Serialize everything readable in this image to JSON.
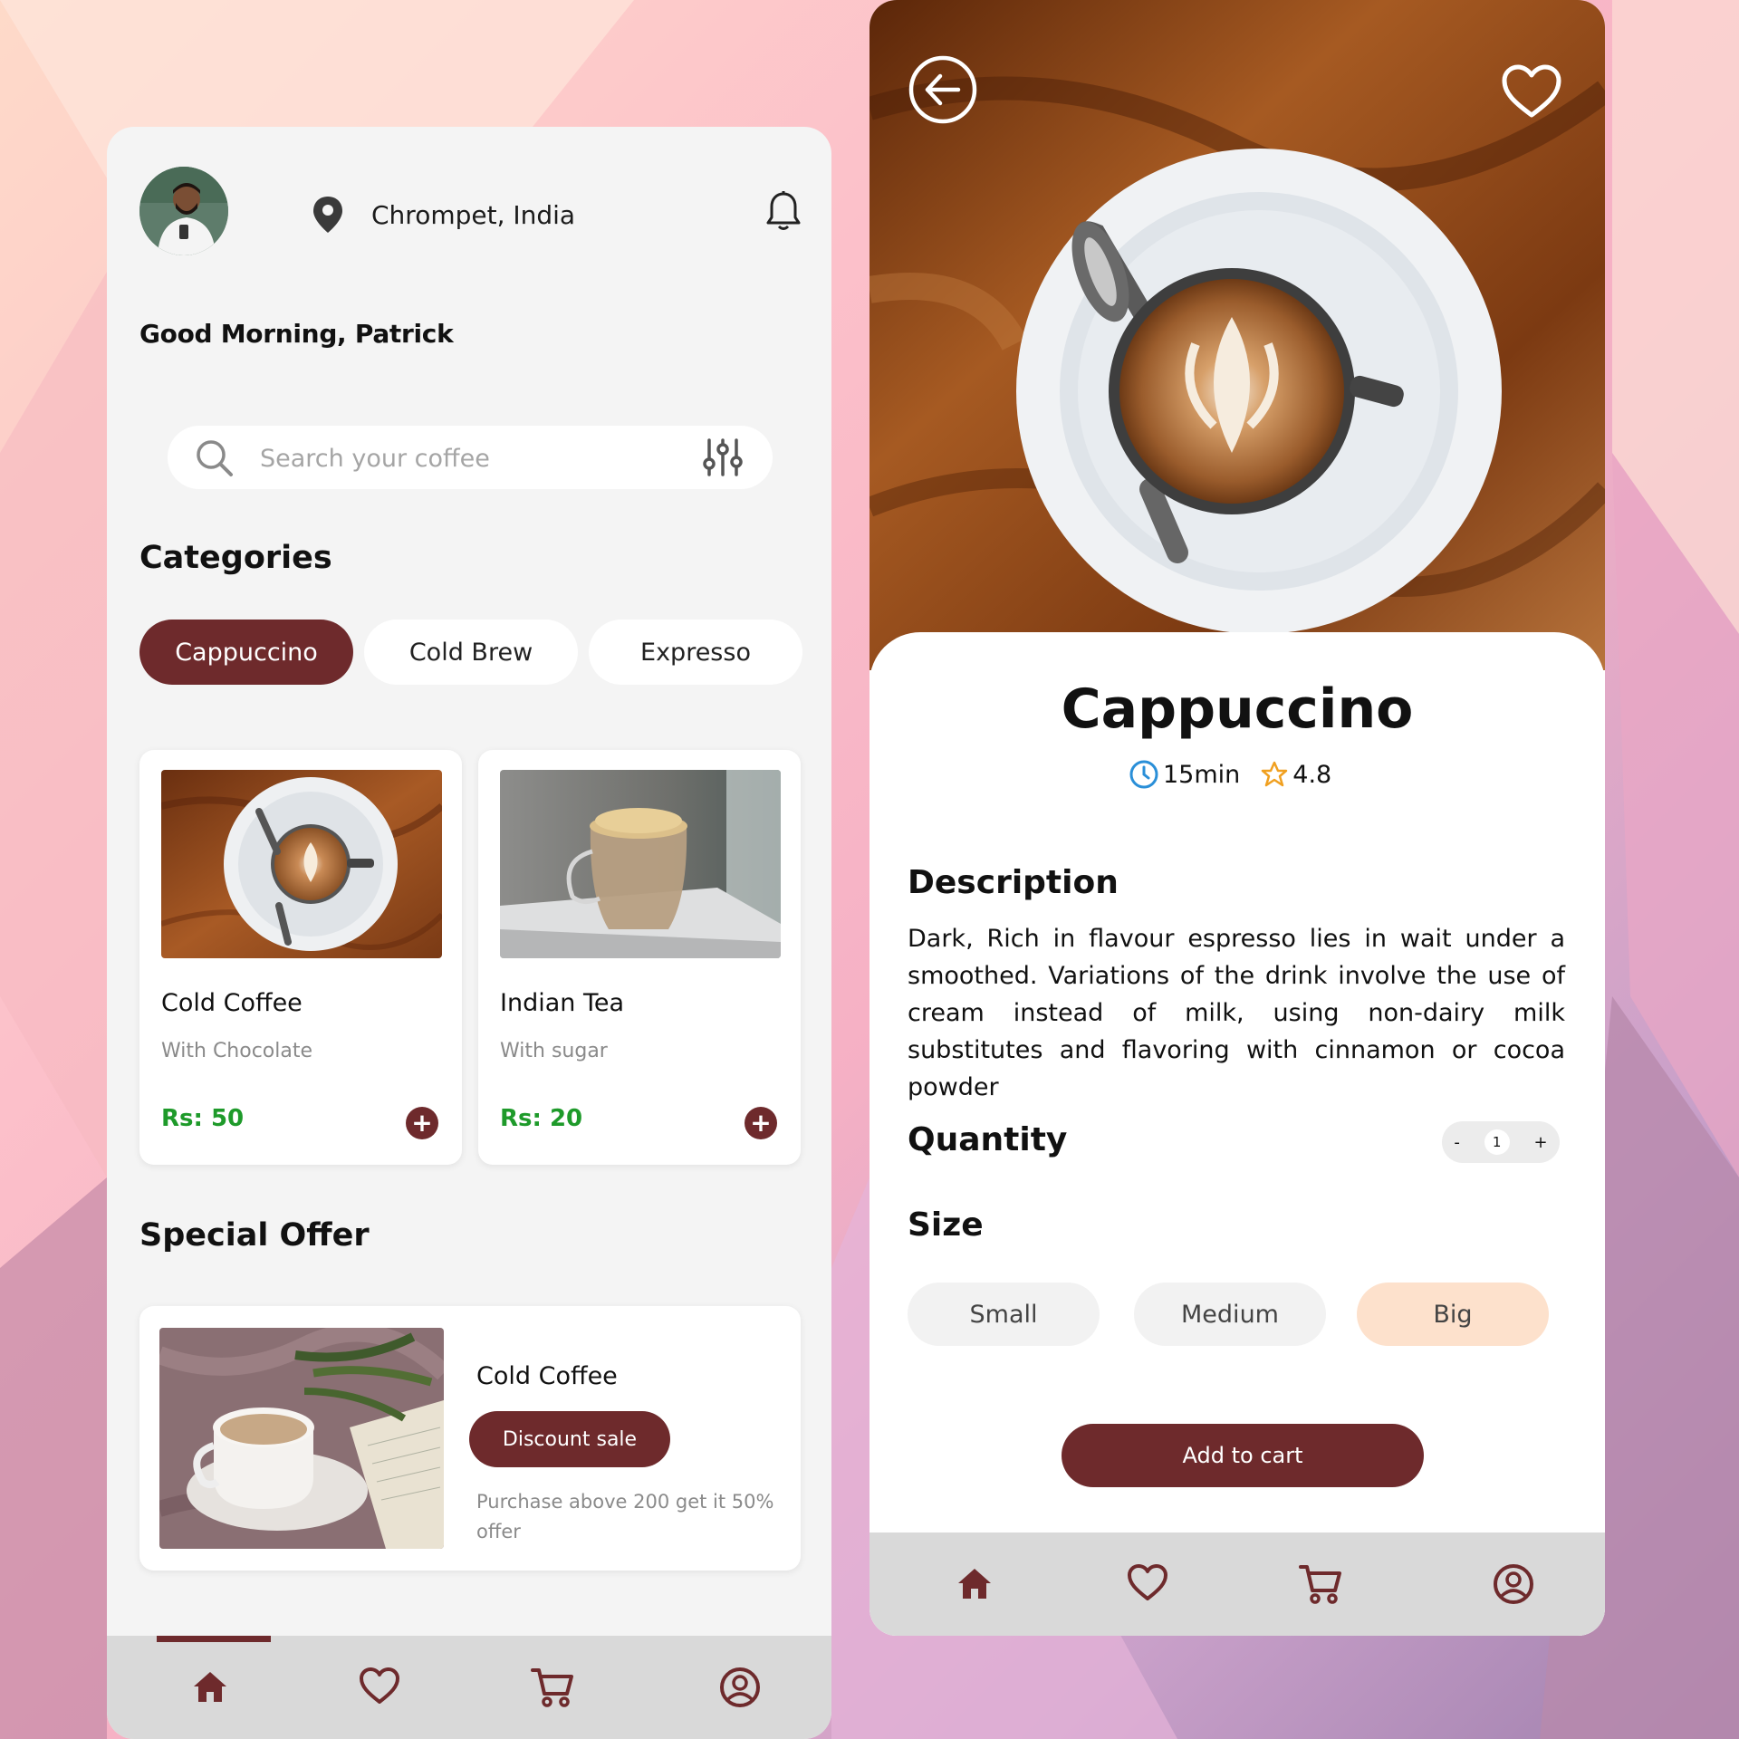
{
  "colors": {
    "accent": "#6e2a2c",
    "price": "#1e9a2a",
    "chip_bg": "#ffffff",
    "size_active": "#fde1cc"
  },
  "home": {
    "location": "Chrompet, India",
    "greeting": "Good Morning, Patrick",
    "search_placeholder": "Search your coffee",
    "categories_title": "Categories",
    "categories": [
      {
        "label": "Cappuccino",
        "active": true
      },
      {
        "label": "Cold Brew",
        "active": false
      },
      {
        "label": "Expresso",
        "active": false
      }
    ],
    "products": [
      {
        "name": "Cold Coffee",
        "subtitle": "With Chocolate",
        "price": "Rs: 50"
      },
      {
        "name": "Indian Tea",
        "subtitle": "With sugar",
        "price": "Rs: 20"
      }
    ],
    "special_offer_title": "Special Offer",
    "offer": {
      "name": "Cold Coffee",
      "badge": "Discount sale",
      "description": "Purchase above 200 get it 50% offer"
    },
    "nav": [
      "home-icon",
      "heart-icon",
      "cart-icon",
      "profile-icon"
    ]
  },
  "detail": {
    "title": "Cappuccino",
    "time": "15min",
    "rating": "4.8",
    "description_title": "Description",
    "description": "Dark, Rich in flavour espresso lies in wait under a smoothed. Variations of the drink involve the use of cream instead of milk, using non-dairy milk substitutes and flavoring with cinnamon or cocoa powder",
    "quantity_title": "Quantity",
    "quantity": {
      "minus": "-",
      "value": "1",
      "plus": "+"
    },
    "size_title": "Size",
    "sizes": [
      {
        "label": "Small",
        "active": false
      },
      {
        "label": "Medium",
        "active": false
      },
      {
        "label": "Big",
        "active": true
      }
    ],
    "add_to_cart": "Add to cart",
    "nav": [
      "home-icon",
      "heart-icon",
      "cart-icon",
      "profile-icon"
    ]
  }
}
